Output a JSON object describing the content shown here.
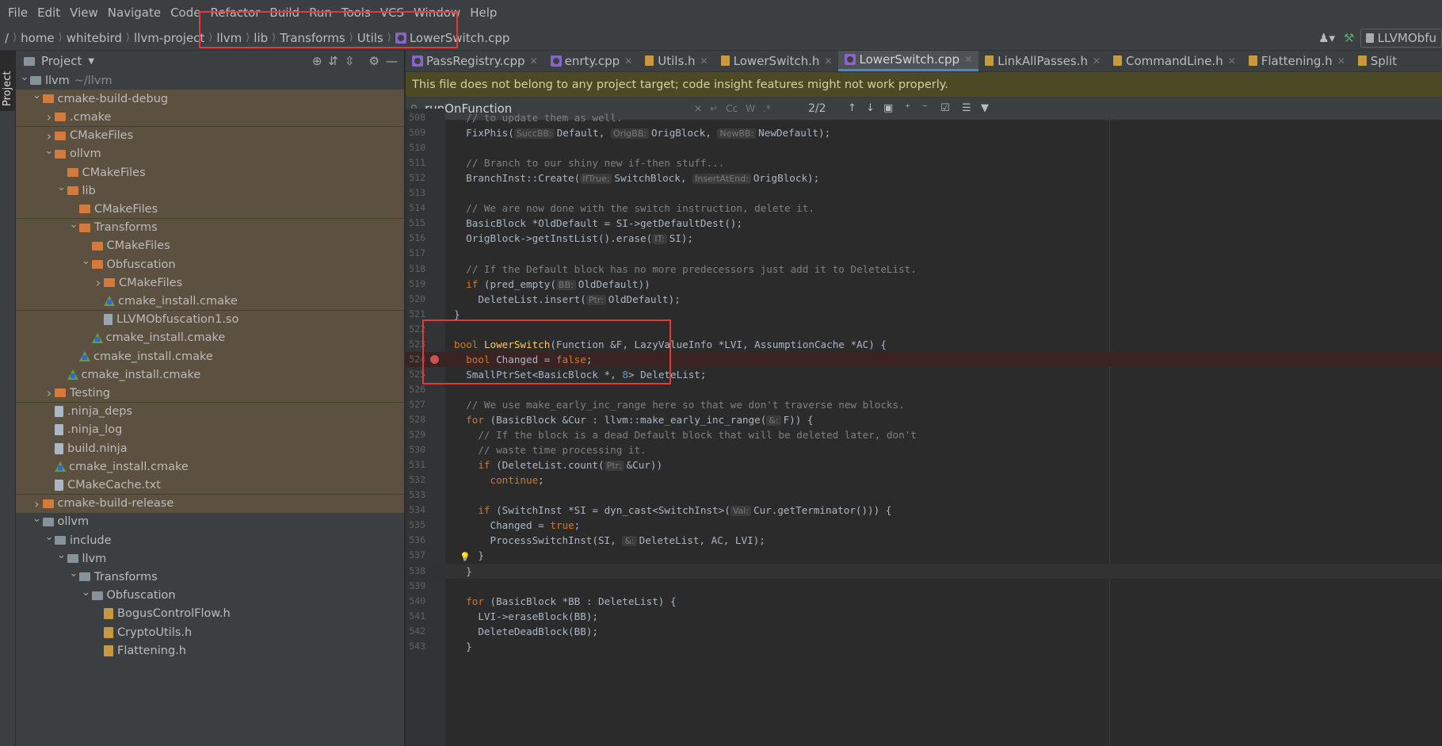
{
  "menu": [
    "File",
    "Edit",
    "View",
    "Navigate",
    "Code",
    "Refactor",
    "Build",
    "Run",
    "Tools",
    "VCS",
    "Window",
    "Help"
  ],
  "breadcrumb": [
    "/",
    "home",
    "whitebird",
    "llvm-project",
    "llvm",
    "lib",
    "Transforms",
    "Utils",
    "LowerSwitch.cpp"
  ],
  "run_config": "LLVMObfu",
  "project_panel": {
    "title": "Project",
    "side_label": "Project",
    "tree": [
      {
        "label": "llvm",
        "extra": "~/llvm",
        "depth": 0,
        "kind": "folder-grey",
        "arrow": "down",
        "hl": false
      },
      {
        "label": "cmake-build-debug",
        "depth": 1,
        "kind": "folder",
        "arrow": "down",
        "hl": true
      },
      {
        "label": ".cmake",
        "depth": 2,
        "kind": "folder",
        "arrow": "right",
        "hl": true
      },
      {
        "label": "CMakeFiles",
        "depth": 2,
        "kind": "folder",
        "arrow": "right",
        "hl": true
      },
      {
        "label": "ollvm",
        "depth": 2,
        "kind": "folder",
        "arrow": "down",
        "hl": true
      },
      {
        "label": "CMakeFiles",
        "depth": 3,
        "kind": "folder",
        "arrow": "",
        "hl": true
      },
      {
        "label": "lib",
        "depth": 3,
        "kind": "folder",
        "arrow": "down",
        "hl": true
      },
      {
        "label": "CMakeFiles",
        "depth": 4,
        "kind": "folder",
        "arrow": "",
        "hl": true
      },
      {
        "label": "Transforms",
        "depth": 4,
        "kind": "folder",
        "arrow": "down",
        "hl": true
      },
      {
        "label": "CMakeFiles",
        "depth": 5,
        "kind": "folder",
        "arrow": "",
        "hl": true
      },
      {
        "label": "Obfuscation",
        "depth": 5,
        "kind": "folder",
        "arrow": "down",
        "hl": true
      },
      {
        "label": "CMakeFiles",
        "depth": 6,
        "kind": "folder",
        "arrow": "right",
        "hl": true
      },
      {
        "label": "cmake_install.cmake",
        "depth": 6,
        "kind": "cmake",
        "arrow": "",
        "hl": true
      },
      {
        "label": "LLVMObfuscation1.so",
        "depth": 6,
        "kind": "so",
        "arrow": "",
        "hl": true
      },
      {
        "label": "cmake_install.cmake",
        "depth": 5,
        "kind": "cmake",
        "arrow": "",
        "hl": true
      },
      {
        "label": "cmake_install.cmake",
        "depth": 4,
        "kind": "cmake",
        "arrow": "",
        "hl": true
      },
      {
        "label": "cmake_install.cmake",
        "depth": 3,
        "kind": "cmake",
        "arrow": "",
        "hl": true
      },
      {
        "label": "Testing",
        "depth": 2,
        "kind": "folder",
        "arrow": "right",
        "hl": true
      },
      {
        "label": ".ninja_deps",
        "depth": 2,
        "kind": "file",
        "arrow": "",
        "hl": true
      },
      {
        "label": ".ninja_log",
        "depth": 2,
        "kind": "file",
        "arrow": "",
        "hl": true
      },
      {
        "label": "build.ninja",
        "depth": 2,
        "kind": "file",
        "arrow": "",
        "hl": true
      },
      {
        "label": "cmake_install.cmake",
        "depth": 2,
        "kind": "cmake",
        "arrow": "",
        "hl": true
      },
      {
        "label": "CMakeCache.txt",
        "depth": 2,
        "kind": "file",
        "arrow": "",
        "hl": true
      },
      {
        "label": "cmake-build-release",
        "depth": 1,
        "kind": "folder",
        "arrow": "right",
        "hl": true
      },
      {
        "label": "ollvm",
        "depth": 1,
        "kind": "folder-grey",
        "arrow": "down",
        "hl": false
      },
      {
        "label": "include",
        "depth": 2,
        "kind": "folder-grey",
        "arrow": "down",
        "hl": false
      },
      {
        "label": "llvm",
        "depth": 3,
        "kind": "folder-grey",
        "arrow": "down",
        "hl": false
      },
      {
        "label": "Transforms",
        "depth": 4,
        "kind": "folder-grey",
        "arrow": "down",
        "hl": false
      },
      {
        "label": "Obfuscation",
        "depth": 5,
        "kind": "folder-grey",
        "arrow": "down",
        "hl": false
      },
      {
        "label": "BogusControlFlow.h",
        "depth": 6,
        "kind": "h",
        "arrow": "",
        "hl": false
      },
      {
        "label": "CryptoUtils.h",
        "depth": 6,
        "kind": "h",
        "arrow": "",
        "hl": false
      },
      {
        "label": "Flattening.h",
        "depth": 6,
        "kind": "h",
        "arrow": "",
        "hl": false
      }
    ]
  },
  "tabs": [
    {
      "label": "PassRegistry.cpp",
      "kind": "cpp",
      "active": false
    },
    {
      "label": "enrty.cpp",
      "kind": "cpp",
      "active": false
    },
    {
      "label": "Utils.h",
      "kind": "h",
      "active": false
    },
    {
      "label": "LowerSwitch.h",
      "kind": "h",
      "active": false
    },
    {
      "label": "LowerSwitch.cpp",
      "kind": "cpp",
      "active": true
    },
    {
      "label": "LinkAllPasses.h",
      "kind": "h",
      "active": false
    },
    {
      "label": "CommandLine.h",
      "kind": "h",
      "active": false
    },
    {
      "label": "Flattening.h",
      "kind": "h",
      "active": false
    },
    {
      "label": "Split",
      "kind": "h",
      "active": false
    }
  ],
  "banner": "This file does not belong to any project target; code insight features might not work properly.",
  "search": {
    "query": "runOnFunction",
    "count": "2/2",
    "opt_case": "Cc",
    "opt_word": "W",
    "opt_regex": ".*"
  },
  "code": [
    {
      "n": "508",
      "html": "  <span class='cm'>// to update them as well.</span>"
    },
    {
      "n": "509",
      "html": "  FixPhis(<span class='hint'>SuccBB:</span>Default, <span class='hint'>OrigBB:</span>OrigBlock, <span class='hint'>NewBB:</span>NewDefault);"
    },
    {
      "n": "510",
      "html": ""
    },
    {
      "n": "511",
      "html": "  <span class='cm'>// Branch to our shiny new if-then stuff...</span>"
    },
    {
      "n": "512",
      "html": "  BranchInst::Create(<span class='hint'>IfTrue:</span>SwitchBlock, <span class='hint'>InsertAtEnd:</span>OrigBlock);"
    },
    {
      "n": "513",
      "html": ""
    },
    {
      "n": "514",
      "html": "  <span class='cm'>// We are now done with the switch instruction, delete it.</span>"
    },
    {
      "n": "515",
      "html": "  BasicBlock *OldDefault = SI-&gt;getDefaultDest();"
    },
    {
      "n": "516",
      "html": "  OrigBlock-&gt;getInstList().erase(<span class='hint'>IT:</span>SI);"
    },
    {
      "n": "517",
      "html": ""
    },
    {
      "n": "518",
      "html": "  <span class='cm'>// If the Default block has no more predecessors just add it to DeleteList.</span>"
    },
    {
      "n": "519",
      "html": "  <span class='kw'>if</span> (pred_empty(<span class='hint'>BB:</span>OldDefault))"
    },
    {
      "n": "520",
      "html": "    DeleteList.insert(<span class='hint'>Ptr:</span>OldDefault);"
    },
    {
      "n": "521",
      "html": "}"
    },
    {
      "n": "522",
      "html": ""
    },
    {
      "n": "523",
      "html": "<span class='kw'>bool</span> <span class='fn'>LowerSwitch</span>(Function &amp;F, LazyValueInfo *LVI, AssumptionCache *AC) {"
    },
    {
      "n": "524",
      "html": "  <span class='kw'>bool</span> Changed = <span class='kw'>false</span>;",
      "bp": true
    },
    {
      "n": "525",
      "html": "  SmallPtrSet&lt;BasicBlock *, <span class='num'>8</span>&gt; DeleteList;"
    },
    {
      "n": "526",
      "html": ""
    },
    {
      "n": "527",
      "html": "  <span class='cm'>// We use make_early_inc_range here so that we don't traverse new blocks.</span>"
    },
    {
      "n": "528",
      "html": "  <span class='kw'>for</span> (BasicBlock &amp;Cur : llvm::make_early_inc_range(<span class='hint'>&amp;:</span>F)) {"
    },
    {
      "n": "529",
      "html": "    <span class='cm'>// If the block is a dead Default block that will be deleted later, don't</span>"
    },
    {
      "n": "530",
      "html": "    <span class='cm'>// waste time processing it.</span>"
    },
    {
      "n": "531",
      "html": "    <span class='kw'>if</span> (DeleteList.count(<span class='hint'>Ptr:</span>&amp;Cur))"
    },
    {
      "n": "532",
      "html": "      <span class='kw'>continue</span>;"
    },
    {
      "n": "533",
      "html": ""
    },
    {
      "n": "534",
      "html": "    <span class='kw'>if</span> (SwitchInst *SI = dyn_cast&lt;SwitchInst&gt;(<span class='hint'>Val:</span>Cur.getTerminator())) {"
    },
    {
      "n": "535",
      "html": "      Changed = <span class='kw'>true</span>;"
    },
    {
      "n": "536",
      "html": "      ProcessSwitchInst(SI, <span class='hint'>&amp;:</span>DeleteList, AC, LVI);"
    },
    {
      "n": "537",
      "html": "    }",
      "bulb": true
    },
    {
      "n": "538",
      "html": "  }",
      "cur": true
    },
    {
      "n": "539",
      "html": ""
    },
    {
      "n": "540",
      "html": "  <span class='kw'>for</span> (BasicBlock *BB : DeleteList) {"
    },
    {
      "n": "541",
      "html": "    LVI-&gt;eraseBlock(BB);"
    },
    {
      "n": "542",
      "html": "    DeleteDeadBlock(BB);"
    },
    {
      "n": "543",
      "html": "  }"
    }
  ]
}
